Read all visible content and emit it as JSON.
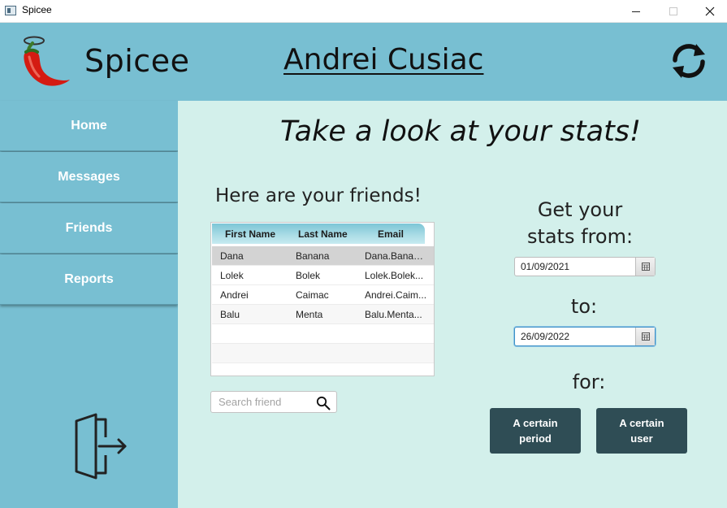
{
  "window": {
    "title": "Spicee",
    "icons": {
      "app": "window-app-icon",
      "minimize": "minimize-icon",
      "maximize": "maximize-icon",
      "close": "close-icon"
    }
  },
  "header": {
    "brand": "Spicee",
    "username": "Andrei Cusiac",
    "logo_icon": "chili-pepper-halo-icon",
    "refresh_icon": "refresh-icon",
    "background": "#78bfd2"
  },
  "sidebar": {
    "items": [
      {
        "label": "Home"
      },
      {
        "label": "Messages"
      },
      {
        "label": "Friends"
      },
      {
        "label": "Reports"
      }
    ],
    "logout_icon": "logout-door-icon"
  },
  "main": {
    "title": "Take a look at your stats!",
    "friends_heading": "Here are your friends!",
    "background": "#d3f0eb",
    "table": {
      "columns": [
        "First Name",
        "Last Name",
        "Email"
      ],
      "rows": [
        {
          "first": "Dana",
          "last": "Banana",
          "email": "Dana.Banana..."
        },
        {
          "first": "Lolek",
          "last": "Bolek",
          "email": "Lolek.Bolek..."
        },
        {
          "first": "Andrei",
          "last": "Caimac",
          "email": "Andrei.Caim..."
        },
        {
          "first": "Balu",
          "last": "Menta",
          "email": "Balu.Menta..."
        }
      ],
      "selected_row": 0
    },
    "search": {
      "placeholder": "Search friend",
      "value": "",
      "icon": "search-icon"
    },
    "stats": {
      "from_label_line1": "Get your",
      "from_label_line2": "stats from:",
      "from_date": "01/09/2021",
      "to_label": "to:",
      "to_date": "26/09/2022",
      "for_label": "for:",
      "calendar_icon": "calendar-icon",
      "buttons": [
        {
          "line1": "A certain",
          "line2": "period"
        },
        {
          "line1": "A certain",
          "line2": "user"
        }
      ],
      "button_color": "#2f4d55"
    }
  }
}
